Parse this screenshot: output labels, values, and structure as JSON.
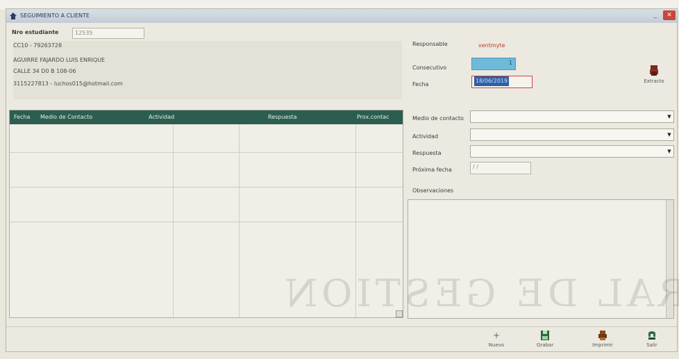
{
  "window": {
    "title": "SEGUIMIENTO A CLIENTE",
    "min_label": "_",
    "close_label": "✕"
  },
  "header": {
    "nro_estudiante_label": "Nro estudiante",
    "nro_estudiante_value": "12535",
    "responsable_label": "Responsable",
    "responsable_value": "ventmyte",
    "consecutivo_label": "Consecutivo",
    "consecutivo_value": "1",
    "fecha_label": "Fecha",
    "fecha_value": "18/06/2019",
    "extracto_label": "Extracto"
  },
  "client": {
    "lines": [
      "CC10 - 79263728",
      "AGUIRRE FAJARDO LUIS ENRIQUE",
      "CALLE 34 D0 B 108-06",
      "3115227813 - luchos015@hotmail.com"
    ]
  },
  "grid": {
    "headers": [
      "Fecha",
      "Medio de Contacto",
      "Actividad",
      "Respuesta",
      "Prox.contac"
    ]
  },
  "form": {
    "medio_label": "Medio de contacto",
    "actividad_label": "Actividad",
    "respuesta_label": "Respuesta",
    "proxima_label": "Próxima fecha",
    "proxima_value": "/ /",
    "observaciones_label": "Observaciones"
  },
  "watermark": "NERAL DE GESTION",
  "toolbar": {
    "nuevo": "Nuevo",
    "grabar": "Grabar",
    "imprimir": "Imprimir",
    "salir": "Salir"
  },
  "colors": {
    "grid_header": "#2c5e50",
    "highlight_field": "#6fb9da",
    "fecha_field": "#2d5fa8",
    "close_button": "#c9463d"
  }
}
